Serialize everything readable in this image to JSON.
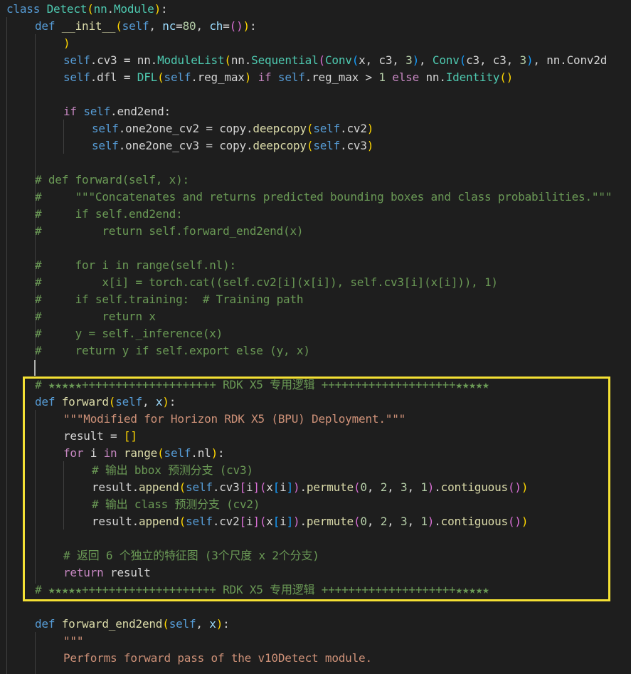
{
  "colors": {
    "background": "#1e1e1e",
    "highlight_box": "#f5e134"
  },
  "lines": [
    {
      "row": 0,
      "indent": 0,
      "tokens": [
        [
          "class",
          "kw"
        ],
        [
          " ",
          "pl"
        ],
        [
          "Detect",
          "cls"
        ],
        [
          "(",
          "p1"
        ],
        [
          "nn",
          "cls"
        ],
        [
          ".",
          "pl"
        ],
        [
          "Module",
          "cls"
        ],
        [
          ")",
          "p1"
        ],
        [
          ":",
          "pl"
        ]
      ]
    },
    {
      "row": 1,
      "indent": 1,
      "tokens": [
        [
          "def",
          "kw"
        ],
        [
          " ",
          "pl"
        ],
        [
          "__init__",
          "fn"
        ],
        [
          "(",
          "p1"
        ],
        [
          "self",
          "slf"
        ],
        [
          ", ",
          "pl"
        ],
        [
          "nc",
          "var"
        ],
        [
          "=",
          "op"
        ],
        [
          "80",
          "num"
        ],
        [
          ", ",
          "pl"
        ],
        [
          "ch",
          "var"
        ],
        [
          "=",
          "op"
        ],
        [
          "()",
          "p2"
        ],
        [
          ")",
          "p1"
        ],
        [
          ":",
          "pl"
        ]
      ]
    },
    {
      "row": 2,
      "indent": 2,
      "tokens": [
        [
          ")",
          "p1"
        ]
      ]
    },
    {
      "row": 3,
      "indent": 2,
      "tokens": [
        [
          "self",
          "slf"
        ],
        [
          ".cv3 = nn.",
          "pl"
        ],
        [
          "ModuleList",
          "cls"
        ],
        [
          "(",
          "p1"
        ],
        [
          "nn.",
          "pl"
        ],
        [
          "Sequential",
          "cls"
        ],
        [
          "(",
          "p2"
        ],
        [
          "Conv",
          "cls"
        ],
        [
          "(",
          "p3"
        ],
        [
          "x, c3, ",
          "pl"
        ],
        [
          "3",
          "num"
        ],
        [
          ")",
          "p3"
        ],
        [
          ", ",
          "pl"
        ],
        [
          "Conv",
          "cls"
        ],
        [
          "(",
          "p3"
        ],
        [
          "c3, c3, ",
          "pl"
        ],
        [
          "3",
          "num"
        ],
        [
          ")",
          "p3"
        ],
        [
          ", nn.Conv2d",
          "pl"
        ]
      ]
    },
    {
      "row": 4,
      "indent": 2,
      "tokens": [
        [
          "self",
          "slf"
        ],
        [
          ".dfl = ",
          "pl"
        ],
        [
          "DFL",
          "cls"
        ],
        [
          "(",
          "p1"
        ],
        [
          "self",
          "slf"
        ],
        [
          ".reg_max",
          "pl"
        ],
        [
          ")",
          "p1"
        ],
        [
          " ",
          "pl"
        ],
        [
          "if",
          "ctl"
        ],
        [
          " ",
          "pl"
        ],
        [
          "self",
          "slf"
        ],
        [
          ".reg_max > ",
          "pl"
        ],
        [
          "1",
          "num"
        ],
        [
          " ",
          "pl"
        ],
        [
          "else",
          "ctl"
        ],
        [
          " nn.",
          "pl"
        ],
        [
          "Identity",
          "cls"
        ],
        [
          "()",
          "p1"
        ]
      ]
    },
    {
      "row": 6,
      "indent": 2,
      "tokens": [
        [
          "if",
          "ctl"
        ],
        [
          " ",
          "pl"
        ],
        [
          "self",
          "slf"
        ],
        [
          ".end2end:",
          "pl"
        ]
      ]
    },
    {
      "row": 7,
      "indent": 3,
      "tokens": [
        [
          "self",
          "slf"
        ],
        [
          ".one2one_cv2 = copy.",
          "pl"
        ],
        [
          "deepcopy",
          "fn"
        ],
        [
          "(",
          "p1"
        ],
        [
          "self",
          "slf"
        ],
        [
          ".cv2",
          "pl"
        ],
        [
          ")",
          "p1"
        ]
      ]
    },
    {
      "row": 8,
      "indent": 3,
      "tokens": [
        [
          "self",
          "slf"
        ],
        [
          ".one2one_cv3 = copy.",
          "pl"
        ],
        [
          "deepcopy",
          "fn"
        ],
        [
          "(",
          "p1"
        ],
        [
          "self",
          "slf"
        ],
        [
          ".cv3",
          "pl"
        ],
        [
          ")",
          "p1"
        ]
      ]
    },
    {
      "row": 10,
      "indent": 1,
      "tokens": [
        [
          "# def forward(self, x):",
          "com"
        ]
      ]
    },
    {
      "row": 11,
      "indent": 1,
      "tokens": [
        [
          "#     \"\"\"Concatenates and returns predicted bounding boxes and class probabilities.\"\"\"",
          "com"
        ]
      ]
    },
    {
      "row": 12,
      "indent": 1,
      "tokens": [
        [
          "#     if self.end2end:",
          "com"
        ]
      ]
    },
    {
      "row": 13,
      "indent": 1,
      "tokens": [
        [
          "#         return self.forward_end2end(x)",
          "com"
        ]
      ]
    },
    {
      "row": 15,
      "indent": 1,
      "tokens": [
        [
          "#     for i in range(self.nl):",
          "com"
        ]
      ]
    },
    {
      "row": 16,
      "indent": 1,
      "tokens": [
        [
          "#         x[i] = torch.cat((self.cv2[i](x[i]), self.cv3[i](x[i])), 1)",
          "com"
        ]
      ]
    },
    {
      "row": 17,
      "indent": 1,
      "tokens": [
        [
          "#     if self.training:  # Training path",
          "com"
        ]
      ]
    },
    {
      "row": 18,
      "indent": 1,
      "tokens": [
        [
          "#         return x",
          "com"
        ]
      ]
    },
    {
      "row": 19,
      "indent": 1,
      "tokens": [
        [
          "#     y = self._inference(x)",
          "com"
        ]
      ]
    },
    {
      "row": 20,
      "indent": 1,
      "tokens": [
        [
          "#     return y if self.export else (y, x)",
          "com"
        ]
      ]
    },
    {
      "row": 22,
      "indent": 1,
      "tokens": [
        [
          "# ★★★★★++++++++++++++++++++ RDK X5 专用逻辑 ++++++++++++++++++++★★★★★",
          "com"
        ]
      ]
    },
    {
      "row": 23,
      "indent": 1,
      "tokens": [
        [
          "def",
          "kw"
        ],
        [
          " ",
          "pl"
        ],
        [
          "forward",
          "fn"
        ],
        [
          "(",
          "p1"
        ],
        [
          "self",
          "slf"
        ],
        [
          ", ",
          "pl"
        ],
        [
          "x",
          "var"
        ],
        [
          ")",
          "p1"
        ],
        [
          ":",
          "pl"
        ]
      ]
    },
    {
      "row": 24,
      "indent": 2,
      "tokens": [
        [
          "\"\"\"Modified for Horizon RDK X5 (BPU) Deployment.\"\"\"",
          "str"
        ]
      ]
    },
    {
      "row": 25,
      "indent": 2,
      "tokens": [
        [
          "result = ",
          "pl"
        ],
        [
          "[]",
          "p1"
        ]
      ]
    },
    {
      "row": 26,
      "indent": 2,
      "tokens": [
        [
          "for",
          "ctl"
        ],
        [
          " i ",
          "pl"
        ],
        [
          "in",
          "ctl"
        ],
        [
          " ",
          "pl"
        ],
        [
          "range",
          "fn"
        ],
        [
          "(",
          "p1"
        ],
        [
          "self",
          "slf"
        ],
        [
          ".nl",
          "pl"
        ],
        [
          ")",
          "p1"
        ],
        [
          ":",
          "pl"
        ]
      ]
    },
    {
      "row": 27,
      "indent": 3,
      "tokens": [
        [
          "# 输出 bbox 预测分支 (cv3)",
          "com"
        ]
      ]
    },
    {
      "row": 28,
      "indent": 3,
      "tokens": [
        [
          "result.",
          "pl"
        ],
        [
          "append",
          "fn"
        ],
        [
          "(",
          "p1"
        ],
        [
          "self",
          "slf"
        ],
        [
          ".cv3",
          "pl"
        ],
        [
          "[",
          "p2"
        ],
        [
          "i",
          "pl"
        ],
        [
          "]",
          "p2"
        ],
        [
          "(",
          "p2"
        ],
        [
          "x",
          "pl"
        ],
        [
          "[",
          "p3"
        ],
        [
          "i",
          "pl"
        ],
        [
          "]",
          "p3"
        ],
        [
          ")",
          "p2"
        ],
        [
          ".",
          "pl"
        ],
        [
          "permute",
          "fn"
        ],
        [
          "(",
          "p2"
        ],
        [
          "0",
          "num"
        ],
        [
          ", ",
          "pl"
        ],
        [
          "2",
          "num"
        ],
        [
          ", ",
          "pl"
        ],
        [
          "3",
          "num"
        ],
        [
          ", ",
          "pl"
        ],
        [
          "1",
          "num"
        ],
        [
          ")",
          "p2"
        ],
        [
          ".",
          "pl"
        ],
        [
          "contiguous",
          "fn"
        ],
        [
          "()",
          "p2"
        ],
        [
          ")",
          "p1"
        ]
      ]
    },
    {
      "row": 29,
      "indent": 3,
      "tokens": [
        [
          "# 输出 class 预测分支 (cv2)",
          "com"
        ]
      ]
    },
    {
      "row": 30,
      "indent": 3,
      "tokens": [
        [
          "result.",
          "pl"
        ],
        [
          "append",
          "fn"
        ],
        [
          "(",
          "p1"
        ],
        [
          "self",
          "slf"
        ],
        [
          ".cv2",
          "pl"
        ],
        [
          "[",
          "p2"
        ],
        [
          "i",
          "pl"
        ],
        [
          "]",
          "p2"
        ],
        [
          "(",
          "p2"
        ],
        [
          "x",
          "pl"
        ],
        [
          "[",
          "p3"
        ],
        [
          "i",
          "pl"
        ],
        [
          "]",
          "p3"
        ],
        [
          ")",
          "p2"
        ],
        [
          ".",
          "pl"
        ],
        [
          "permute",
          "fn"
        ],
        [
          "(",
          "p2"
        ],
        [
          "0",
          "num"
        ],
        [
          ", ",
          "pl"
        ],
        [
          "2",
          "num"
        ],
        [
          ", ",
          "pl"
        ],
        [
          "3",
          "num"
        ],
        [
          ", ",
          "pl"
        ],
        [
          "1",
          "num"
        ],
        [
          ")",
          "p2"
        ],
        [
          ".",
          "pl"
        ],
        [
          "contiguous",
          "fn"
        ],
        [
          "()",
          "p2"
        ],
        [
          ")",
          "p1"
        ]
      ]
    },
    {
      "row": 32,
      "indent": 2,
      "tokens": [
        [
          "# 返回 6 个独立的特征图 (3个尺度 x 2个分支)",
          "com"
        ]
      ]
    },
    {
      "row": 33,
      "indent": 2,
      "tokens": [
        [
          "return",
          "ctl"
        ],
        [
          " result",
          "pl"
        ]
      ]
    },
    {
      "row": 34,
      "indent": 1,
      "tokens": [
        [
          "# ★★★★★++++++++++++++++++++ RDK X5 专用逻辑 ++++++++++++++++++++★★★★★",
          "com"
        ]
      ]
    },
    {
      "row": 36,
      "indent": 1,
      "tokens": [
        [
          "def",
          "kw"
        ],
        [
          " ",
          "pl"
        ],
        [
          "forward_end2end",
          "fn"
        ],
        [
          "(",
          "p1"
        ],
        [
          "self",
          "slf"
        ],
        [
          ", ",
          "pl"
        ],
        [
          "x",
          "var"
        ],
        [
          ")",
          "p1"
        ],
        [
          ":",
          "pl"
        ]
      ]
    },
    {
      "row": 37,
      "indent": 2,
      "tokens": [
        [
          "\"\"\"",
          "str"
        ]
      ]
    },
    {
      "row": 38,
      "indent": 2,
      "tokens": [
        [
          "Performs forward pass of the v10Detect module.",
          "str"
        ]
      ]
    }
  ]
}
